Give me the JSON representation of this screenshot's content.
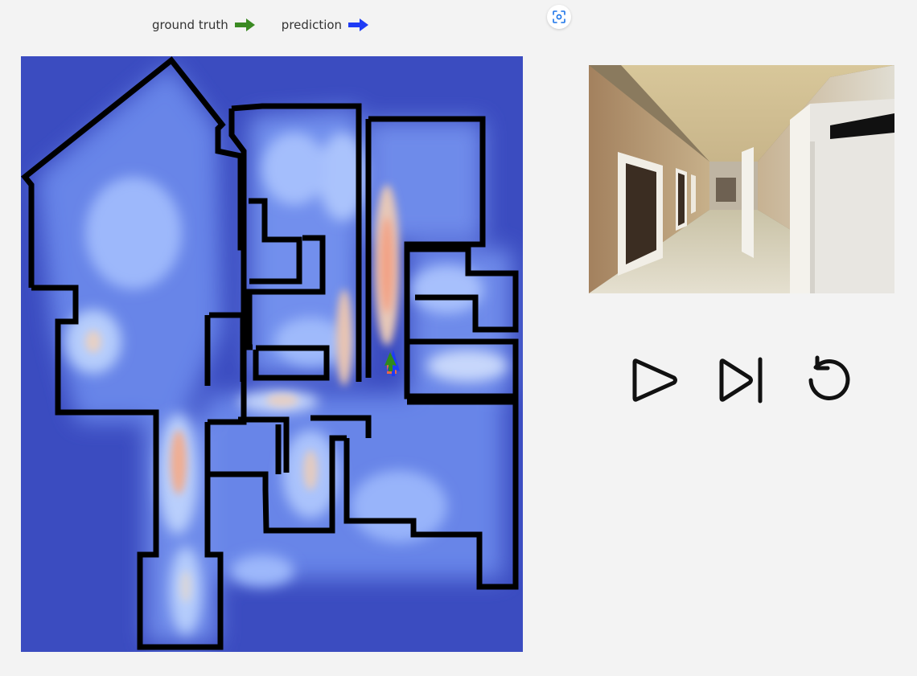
{
  "legend": {
    "ground_truth_label": "ground truth",
    "prediction_label": "prediction",
    "ground_truth_color": "#3a8a22",
    "prediction_color": "#1f3cf5"
  },
  "toolbar": {
    "screenshot_icon": "focus-capture-icon"
  },
  "map": {
    "background_color": "#3b4cc0",
    "wall_color": "#000000",
    "heat_colors": [
      "#3b4cc0",
      "#8fb0fe",
      "#dddcdc",
      "#f49a7b",
      "#b40426"
    ]
  },
  "controls": {
    "play_icon": "play-icon",
    "step_icon": "skip-forward-icon",
    "reset_icon": "reset-icon"
  }
}
